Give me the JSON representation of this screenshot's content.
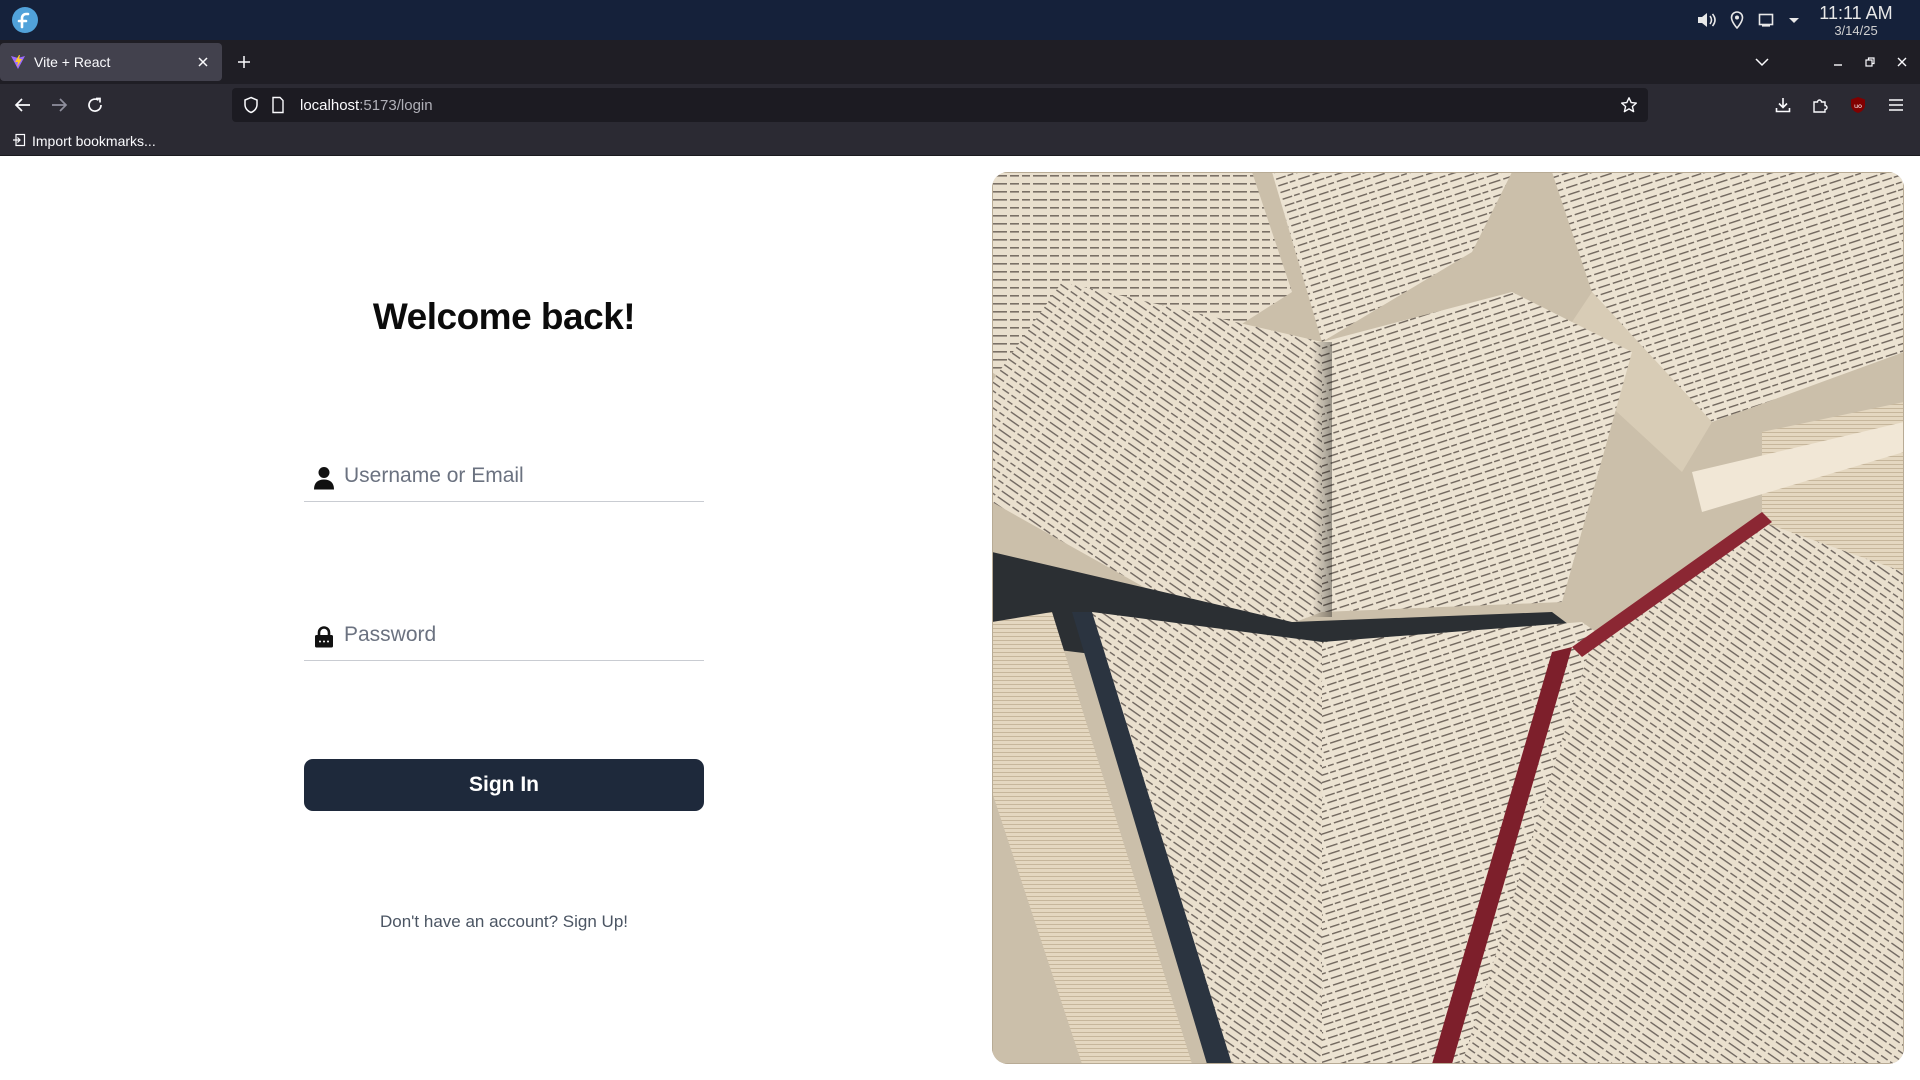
{
  "os": {
    "time": "11:11 AM",
    "date": "3/14/25",
    "icons": [
      "fedora-logo-icon",
      "volume-icon",
      "location-icon",
      "screen-icon",
      "dropdown-icon"
    ]
  },
  "browser": {
    "tab_title": "Vite + React",
    "url_host": "localhost",
    "url_path": ":5173/login",
    "bookmark_label": "Import bookmarks..."
  },
  "login": {
    "heading": "Welcome back!",
    "username_placeholder": "Username or Email",
    "username_value": "",
    "password_placeholder": "Password",
    "password_value": "",
    "signin_label": "Sign In",
    "signup_text": "Don't have an account? Sign Up!"
  },
  "colors": {
    "os_bar": "#15213a",
    "tabstrip": "#1f1e25",
    "toolbar": "#2b2a33",
    "button": "#1e293b",
    "accent_text": "#4b5563"
  }
}
